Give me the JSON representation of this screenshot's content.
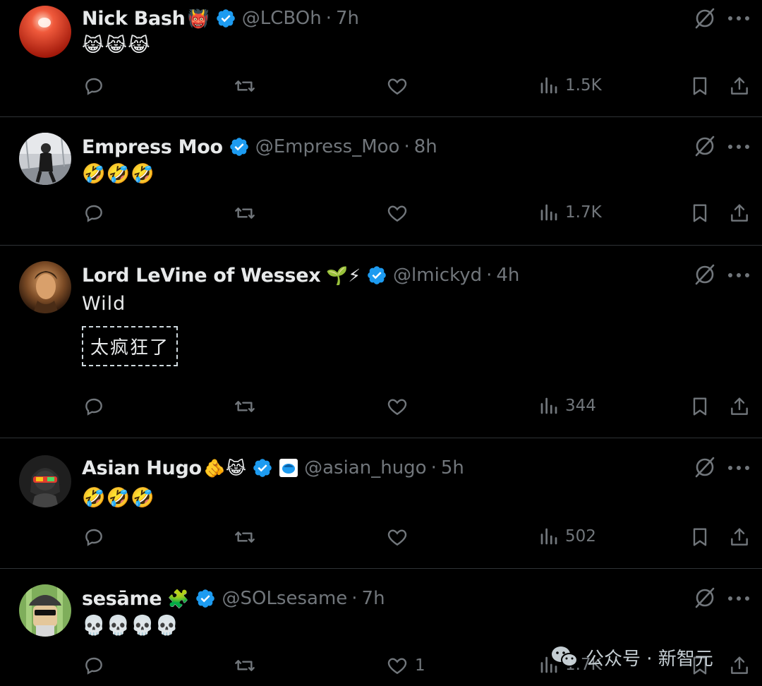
{
  "tweets": [
    {
      "name": "Nick Bash",
      "name_emoji": "👹",
      "verified": true,
      "handle": "@LCBOh",
      "time": "7h",
      "text": "😹😹😹",
      "views": "1.5K",
      "likes": "",
      "avatar": "red-orb"
    },
    {
      "name": "Empress Moo",
      "name_emoji": "",
      "verified": true,
      "handle": "@Empress_Moo",
      "time": "8h",
      "text": "🤣🤣🤣",
      "views": "1.7K",
      "likes": "",
      "avatar": "snow-figure"
    },
    {
      "name": "Lord LeVine of Wessex",
      "name_emoji": "🌱⚡",
      "verified": true,
      "handle": "@lmickyd",
      "time": "4h",
      "text": "Wild",
      "translation": "太疯狂了",
      "views": "344",
      "likes": "",
      "avatar": "portrait"
    },
    {
      "name": "Asian Hugo",
      "name_emoji": "🫵😹",
      "verified": true,
      "affiliate_badge": true,
      "handle": "@asian_hugo",
      "time": "5h",
      "text": "🤣🤣🤣",
      "views": "502",
      "likes": "",
      "avatar": "sunglasses-character"
    },
    {
      "name": "sesāme",
      "name_emoji": "🧩",
      "verified": true,
      "handle": "@SOLsesame",
      "time": "7h",
      "text": "💀💀💀💀",
      "views": "1.7K",
      "likes": "1",
      "avatar": "green-cap-character"
    }
  ],
  "separator": "·",
  "watermark": {
    "text": "公众号 · 新智元",
    "icon": "wechat-icon"
  },
  "colors": {
    "background": "#000000",
    "primary_text": "#e7e9ea",
    "secondary_text": "#71767b",
    "verified_blue": "#1d9bf0",
    "divider": "#2f3336"
  }
}
